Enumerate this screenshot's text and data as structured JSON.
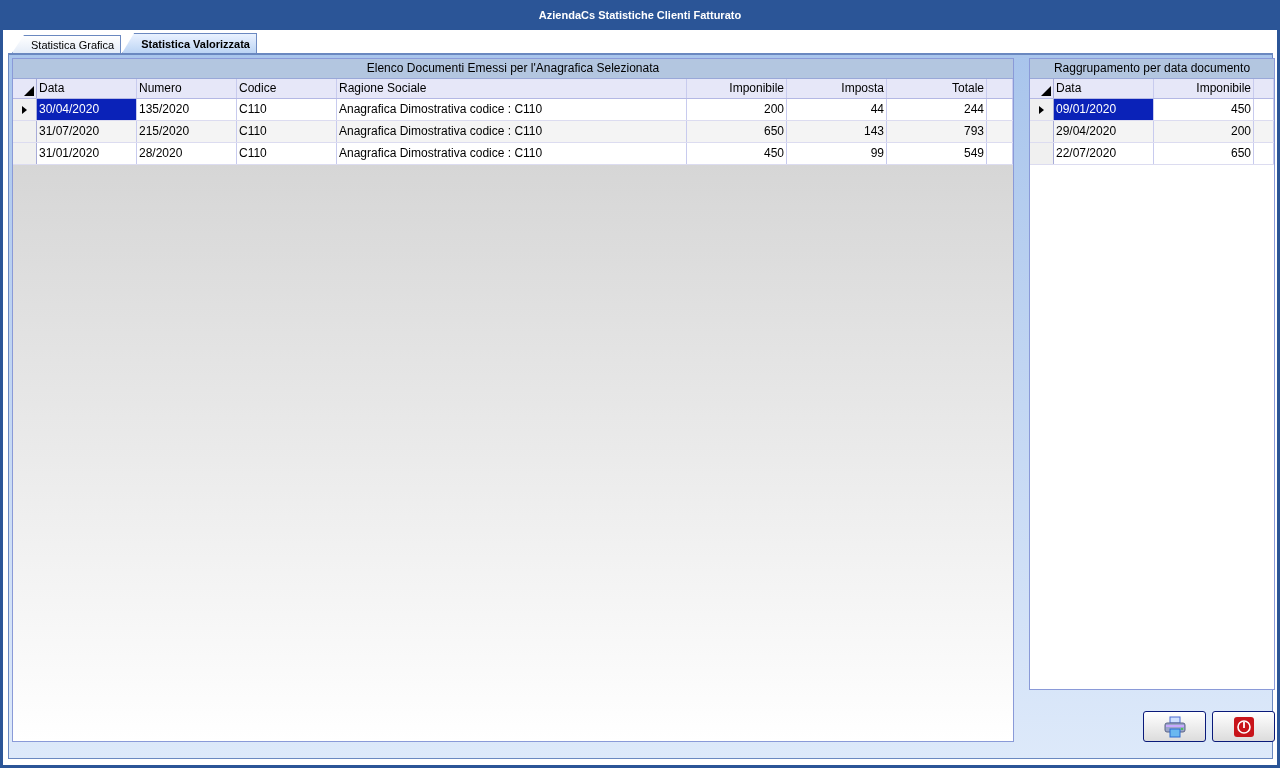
{
  "window": {
    "title": "AziendaCs Statistiche Clienti Fatturato"
  },
  "tabs": [
    {
      "label": "Statistica Grafica",
      "selected": false
    },
    {
      "label": "Statistica Valorizzata",
      "selected": true
    }
  ],
  "grids": [
    {
      "caption": "Elenco Documenti Emessi per l'Anagrafica Selezionata",
      "columns": [
        {
          "label": "Data",
          "kind": "text"
        },
        {
          "label": "Numero",
          "kind": "text"
        },
        {
          "label": "Codice",
          "kind": "text"
        },
        {
          "label": "Ragione Sociale",
          "kind": "wide"
        },
        {
          "label": "Imponibile",
          "kind": "number"
        },
        {
          "label": "Imposta",
          "kind": "number"
        },
        {
          "label": "Totale",
          "kind": "number"
        }
      ],
      "rows": [
        {
          "selected": true,
          "cells": [
            "30/04/2020",
            "135/2020",
            "C110",
            "Anagrafica Dimostrativa codice : C110",
            "200",
            "44",
            "244"
          ]
        },
        {
          "selected": false,
          "cells": [
            "31/07/2020",
            "215/2020",
            "C110",
            "Anagrafica Dimostrativa codice : C110",
            "650",
            "143",
            "793"
          ]
        },
        {
          "selected": false,
          "cells": [
            "31/01/2020",
            "28/2020",
            "C110",
            "Anagrafica Dimostrativa codice : C110",
            "450",
            "99",
            "549"
          ]
        }
      ]
    },
    {
      "caption": "Raggrupamento per data documento",
      "columns": [
        {
          "label": "Data",
          "kind": "text"
        },
        {
          "label": "Imponibile",
          "kind": "number"
        }
      ],
      "rows": [
        {
          "selected": true,
          "cells": [
            "09/01/2020",
            "450"
          ]
        },
        {
          "selected": false,
          "cells": [
            "29/04/2020",
            "200"
          ]
        },
        {
          "selected": false,
          "cells": [
            "22/07/2020",
            "650"
          ]
        }
      ]
    }
  ],
  "buttons": [
    {
      "kind": "print"
    },
    {
      "kind": "exit"
    }
  ]
}
